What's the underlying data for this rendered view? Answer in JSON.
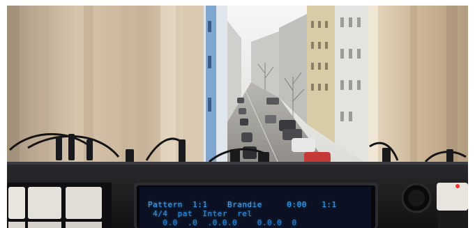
{
  "scene": {
    "description_colors": {
      "curtain": "#cdb9a0",
      "sky": "#efefee",
      "street": "#9a9894",
      "lcd_text": "#3aa6ff",
      "device": "#1c1c20",
      "red_led": "#ff3030"
    }
  },
  "lcd": {
    "line1": "Pattern  1:1    Brandie     0:00   1:1",
    "line2": " 4/4  pat  Inter  rel",
    "line3": "   0.0  .0  .0.0.0    0.0.0  0"
  }
}
